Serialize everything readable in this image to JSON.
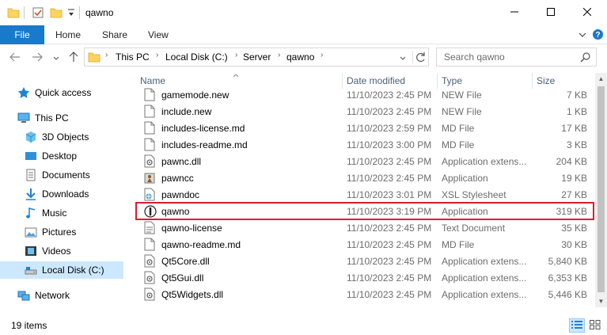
{
  "window": {
    "title": "qawno",
    "minimize_glyph": "—",
    "maximize_glyph": "☐",
    "close_glyph": "✕"
  },
  "ribbon": {
    "tabs": [
      "File",
      "Home",
      "Share",
      "View"
    ],
    "help_glyph": "?"
  },
  "address": {
    "segments": [
      "This PC",
      "Local Disk (C:)",
      "Server",
      "qawno"
    ],
    "search_placeholder": "Search qawno"
  },
  "nav_pane": {
    "items": [
      {
        "label": "Quick access",
        "icon": "star-icon"
      },
      {
        "label": "This PC",
        "icon": "computer-icon"
      },
      {
        "label": "3D Objects",
        "icon": "cube-icon"
      },
      {
        "label": "Desktop",
        "icon": "desktop-icon"
      },
      {
        "label": "Documents",
        "icon": "document-icon"
      },
      {
        "label": "Downloads",
        "icon": "download-icon"
      },
      {
        "label": "Music",
        "icon": "music-icon"
      },
      {
        "label": "Pictures",
        "icon": "pictures-icon"
      },
      {
        "label": "Videos",
        "icon": "video-icon"
      },
      {
        "label": "Local Disk (C:)",
        "icon": "drive-icon"
      },
      {
        "label": "Network",
        "icon": "network-icon"
      }
    ],
    "selected": "Local Disk (C:)"
  },
  "columns": {
    "name": "Name",
    "date": "Date modified",
    "type": "Type",
    "size": "Size"
  },
  "files": [
    {
      "name": "gamemode.new",
      "date": "11/10/2023 2:45 PM",
      "type": "NEW File",
      "size": "7 KB",
      "icon": "file-icon"
    },
    {
      "name": "include.new",
      "date": "11/10/2023 2:45 PM",
      "type": "NEW File",
      "size": "1 KB",
      "icon": "file-icon"
    },
    {
      "name": "includes-license.md",
      "date": "11/10/2023 2:59 PM",
      "type": "MD File",
      "size": "17 KB",
      "icon": "file-icon"
    },
    {
      "name": "includes-readme.md",
      "date": "11/10/2023 3:00 PM",
      "type": "MD File",
      "size": "3 KB",
      "icon": "file-icon"
    },
    {
      "name": "pawnc.dll",
      "date": "11/10/2023 2:45 PM",
      "type": "Application extens...",
      "size": "204 KB",
      "icon": "dll-icon"
    },
    {
      "name": "pawncc",
      "date": "11/10/2023 2:45 PM",
      "type": "Application",
      "size": "19 KB",
      "icon": "application-icon"
    },
    {
      "name": "pawndoc",
      "date": "11/10/2023 3:01 PM",
      "type": "XSL Stylesheet",
      "size": "27 KB",
      "icon": "xsl-icon"
    },
    {
      "name": "qawno",
      "date": "11/10/2023 3:19 PM",
      "type": "Application",
      "size": "319 KB",
      "icon": "qawno-app-icon",
      "highlighted": true
    },
    {
      "name": "qawno-license",
      "date": "11/10/2023 2:45 PM",
      "type": "Text Document",
      "size": "35 KB",
      "icon": "text-file-icon"
    },
    {
      "name": "qawno-readme.md",
      "date": "11/10/2023 2:45 PM",
      "type": "MD File",
      "size": "30 KB",
      "icon": "file-icon"
    },
    {
      "name": "Qt5Core.dll",
      "date": "11/10/2023 2:45 PM",
      "type": "Application extens...",
      "size": "5,840 KB",
      "icon": "dll-icon"
    },
    {
      "name": "Qt5Gui.dll",
      "date": "11/10/2023 2:45 PM",
      "type": "Application extens...",
      "size": "6,353 KB",
      "icon": "dll-icon"
    },
    {
      "name": "Qt5Widgets.dll",
      "date": "11/10/2023 2:45 PM",
      "type": "Application extens...",
      "size": "5,446 KB",
      "icon": "dll-icon"
    }
  ],
  "status": {
    "item_count": "19 items"
  },
  "colors": {
    "accent": "#1979ca",
    "selection": "#cce8ff",
    "highlight_box": "#d81e2c",
    "folder": "#ffd45e"
  }
}
